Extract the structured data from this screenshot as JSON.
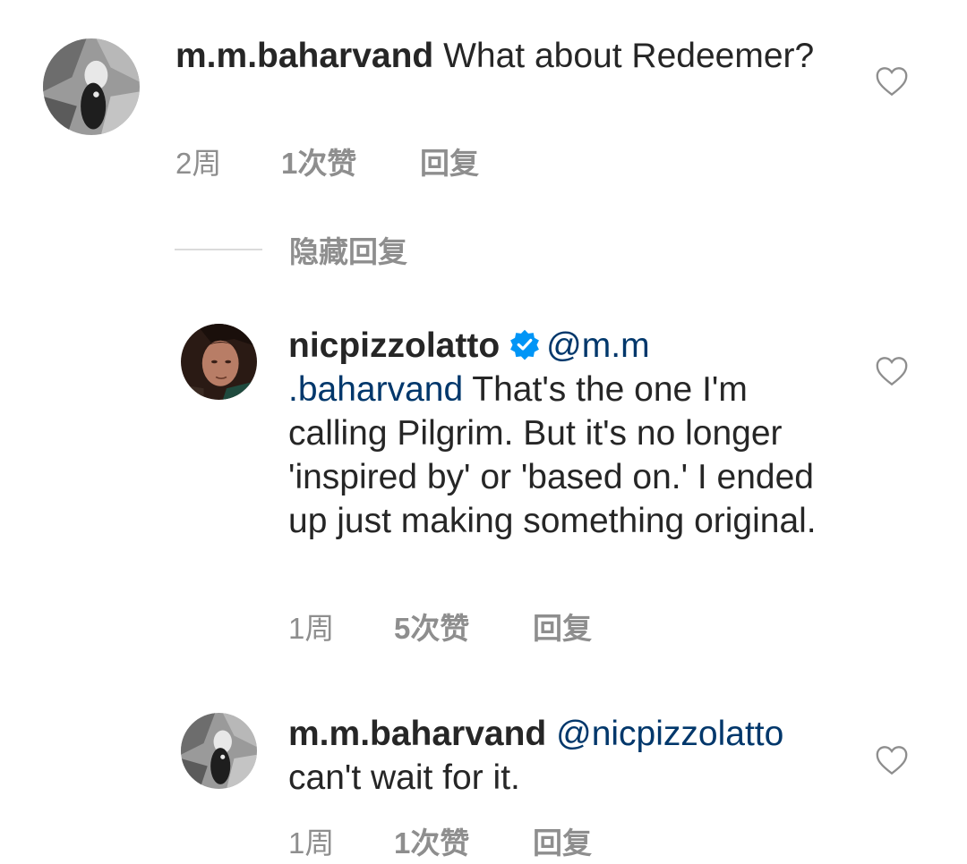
{
  "comments": [
    {
      "username": "m.m.baharvand",
      "mention": "",
      "text": "What about Redeemer?",
      "time": "2周",
      "likes": "1次赞",
      "reply": "回复"
    },
    {
      "username": "nicpizzolatto",
      "verified": true,
      "mention": "@m.m .baharvand",
      "text": "That's the one I'm calling Pilgrim.  But it's no longer 'inspired by' or 'based on.' I ended up just making something original.",
      "time": "1周",
      "likes": "5次赞",
      "reply": "回复"
    },
    {
      "username": "m.m.baharvand",
      "mention": "@nicpizzolatto",
      "text": "can't wait for it.",
      "time": "1周",
      "likes": "1次赞",
      "reply": "回复"
    }
  ],
  "hide_replies_label": "隐藏回复",
  "icons": {
    "like": "heart-outline-icon",
    "verified": "verified-badge-icon"
  },
  "colors": {
    "text": "#262626",
    "secondary": "#8e8e8e",
    "mention": "#00376b",
    "verified": "#0095f6"
  }
}
